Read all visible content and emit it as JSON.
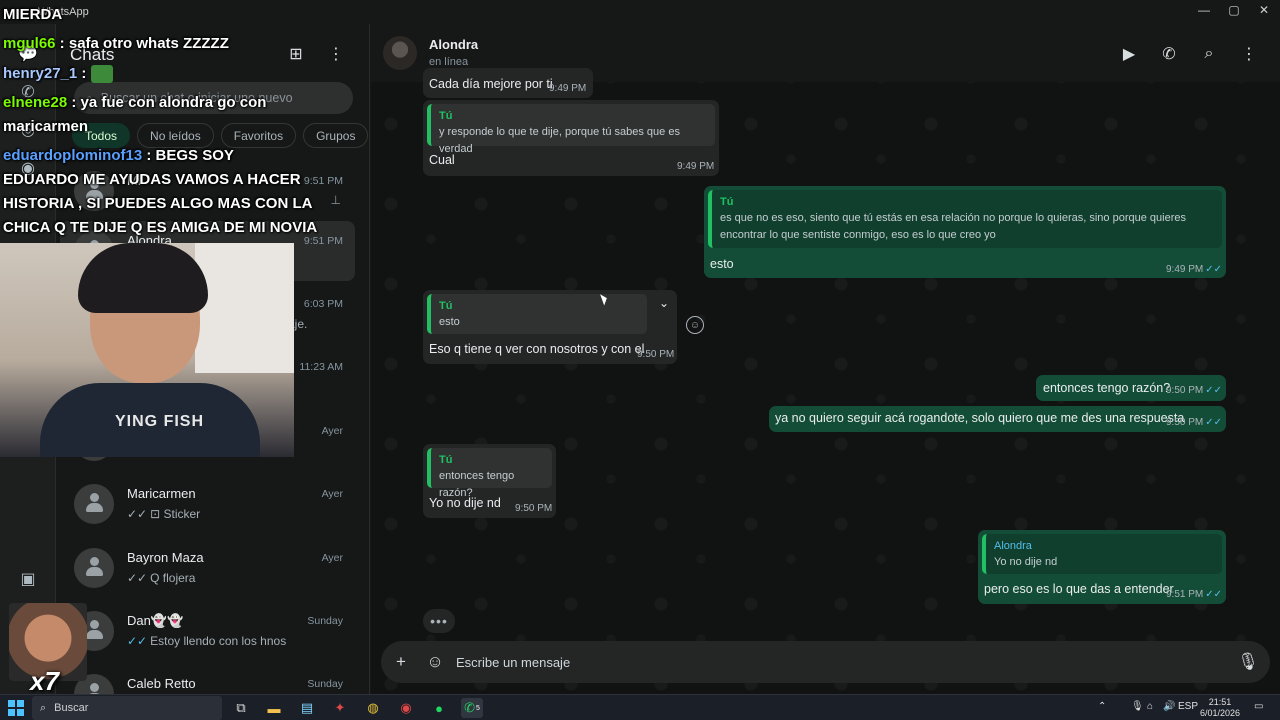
{
  "window": {
    "title": "WhatsApp",
    "minimize": "—",
    "maximize": "▢",
    "close": "✕"
  },
  "stream_chat": [
    {
      "user": "",
      "text": "MIERDA",
      "color": "#ffffff"
    },
    {
      "user": "mgul66",
      "text": " : safa otro whats ZZZZZ",
      "color": "#7cfc00"
    },
    {
      "user": "henry27_1",
      "text": " : ",
      "color": "#a8c8ff"
    },
    {
      "user": "elnene28",
      "text": " : ya fue con alondra go con",
      "color": "#7cfc00"
    },
    {
      "user": "",
      "text": "maricarmen",
      "color": "#ffffff"
    },
    {
      "user": "eduardoplominof13",
      "text": " : BEGS SOY",
      "color": "#5aa0ff"
    },
    {
      "user": "",
      "text": "EDUARDO ME AYUDAS VAMOS A HACER",
      "color": "#ffffff"
    },
    {
      "user": "",
      "text": "HISTORIA , SI PUEDES ALGO MAS CON LA",
      "color": "#ffffff"
    },
    {
      "user": "",
      "text": "CHICA Q TE DIJE Q ES AMIGA DE MI NOVIA",
      "color": "#ffffff"
    }
  ],
  "webcam": {
    "shirt_text": "YING FISH"
  },
  "emote": {
    "label": "x7"
  },
  "chatlist": {
    "title": "Chats",
    "search_placeholder": "Buscar un chat o iniciar uno nuevo",
    "filters": [
      "Todos",
      "No leídos",
      "Favoritos",
      "Grupos"
    ],
    "items": [
      {
        "name": "Mi",
        "time": "9:51 PM",
        "preview": "",
        "ticks": ""
      },
      {
        "name": "Alondra",
        "time": "9:51 PM",
        "preview": "",
        "ticks": ""
      },
      {
        "name": "",
        "time": "6:03 PM",
        "preview": "aje.",
        "ticks": ""
      },
      {
        "name": "",
        "time": "11:23 AM",
        "preview": "",
        "ticks": ""
      },
      {
        "name": "",
        "time": "Ayer",
        "preview": "",
        "ticks": ""
      },
      {
        "name": "Maricarmen",
        "time": "Ayer",
        "preview": "Sticker",
        "ticks": "✓✓"
      },
      {
        "name": "Bayron Maza",
        "time": "Ayer",
        "preview": "Q flojera",
        "ticks": "✓✓"
      },
      {
        "name": "Dan👻👻",
        "time": "Sunday",
        "preview": "Estoy llendo con los hnos",
        "ticks": "✓✓"
      },
      {
        "name": "Caleb Retto",
        "time": "Sunday",
        "preview": "",
        "ticks": ""
      }
    ]
  },
  "conversation": {
    "contact_name": "Alondra",
    "contact_status": "en línea",
    "messages": [
      {
        "dir": "in",
        "quote_author": "",
        "quote_text": "",
        "body": "Cada día mejore por ti",
        "time": "9:49 PM",
        "ticks": ""
      },
      {
        "dir": "in",
        "quote_author": "Tú",
        "quote_text": "y responde lo que te dije, porque tú sabes que es verdad",
        "body": "Cual",
        "time": "9:49 PM",
        "ticks": ""
      },
      {
        "dir": "out",
        "quote_author": "Tú",
        "quote_text": "es que no es eso, siento que tú estás en esa relación no porque lo quieras, sino porque quieres encontrar lo que sentiste conmigo, eso es lo que creo yo",
        "body": "esto",
        "time": "9:49 PM",
        "ticks": "✓✓"
      },
      {
        "dir": "in",
        "quote_author": "Tú",
        "quote_text": "esto",
        "body": "Eso q tiene q ver con nosotros y con el",
        "time": "9:50 PM",
        "ticks": ""
      },
      {
        "dir": "out",
        "quote_author": "",
        "quote_text": "",
        "body": "entonces tengo razón?",
        "time": "9:50 PM",
        "ticks": "✓✓"
      },
      {
        "dir": "out",
        "quote_author": "",
        "quote_text": "",
        "body": "ya no quiero seguir acá rogandote, solo quiero que me des una respuesta",
        "time": "9:50 PM",
        "ticks": "✓✓"
      },
      {
        "dir": "in",
        "quote_author": "Tú",
        "quote_text": "entonces tengo razón?",
        "body": "Yo no dije nd",
        "time": "9:50 PM",
        "ticks": ""
      },
      {
        "dir": "out",
        "quote_author": "Alondra",
        "quote_text": "Yo no dije nd",
        "body": "pero eso es lo que das a entender",
        "time": "9:51 PM",
        "ticks": "✓✓"
      }
    ],
    "typing_indicator": "•••",
    "composer_placeholder": "Escribe un mensaje"
  },
  "taskbar": {
    "search_label": "Buscar",
    "language": "ESP",
    "time": "21:51",
    "date": "6/01/2026",
    "whatsapp_badge": "5"
  },
  "colors": {
    "accent": "#21c063",
    "outgoing_bubble": "#144d37",
    "incoming_bubble": "#242626",
    "read_ticks": "#53bdeb"
  }
}
